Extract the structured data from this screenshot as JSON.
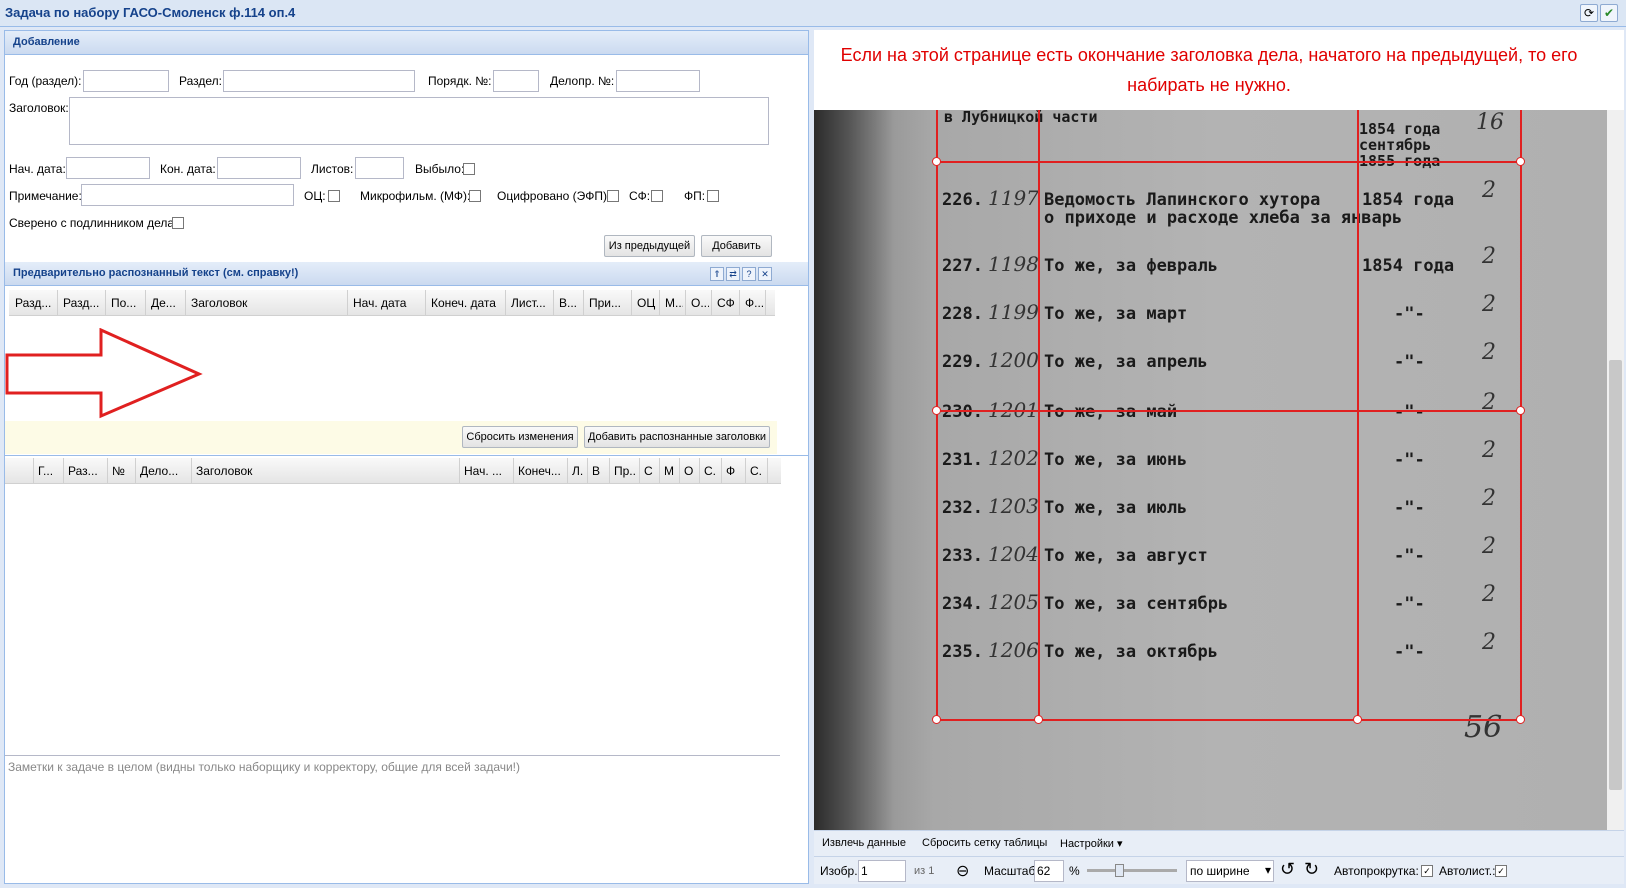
{
  "title": "Задача по набору ГАСО-Смоленск ф.114 оп.4",
  "notice": "Если на этой странице есть окончание заголовка дела, начатого на предыдущей, то его набирать не нужно.",
  "add_panel": {
    "title": "Добавление",
    "year_label": "Год (раздел):",
    "section_label": "Раздел:",
    "order_label": "Порядк. №:",
    "office_no_label": "Делопр. №:",
    "heading_label": "Заголовок:",
    "start_date_label": "Нач. дата:",
    "end_date_label": "Кон. дата:",
    "sheets_label": "Листов:",
    "dropped_label": "Выбыло:",
    "note_label": "Примечание:",
    "oc_label": "ОЦ:",
    "microfilm_label": "Микрофильм. (МФ):",
    "digitized_label": "Оцифровано (ЭФП):",
    "sf_label": "СФ:",
    "fp_label": "ФП:",
    "verified_label": "Сверено с подлинником дела:",
    "from_prev_button": "Из предыдущей",
    "add_button": "Добавить"
  },
  "recognized_panel": {
    "title": "Предварительно распознанный текст (см. справку!)",
    "columns": [
      "Разд...",
      "Разд...",
      "По...",
      "Де...",
      "Заголовок",
      "Нач. дата",
      "Конеч. дата",
      "Лист...",
      "В...",
      "При...",
      "ОЦ",
      "М...",
      "О...",
      "СФ",
      "Ф..."
    ],
    "reset_button": "Сбросить изменения",
    "add_recognized_button": "Добавить распознанные заголовки"
  },
  "main_grid": {
    "columns": [
      "Г...",
      "Раз...",
      "№",
      "Дело...",
      "Заголовок",
      "Нач. ...",
      "Конеч...",
      "Л.",
      "В",
      "Пр...",
      "С",
      "М",
      "О",
      "С.",
      "Ф",
      "С."
    ]
  },
  "notes_placeholder": "Заметки к задаче в целом (видны только наборщику и корректору, общие для всей задачи!)",
  "document": {
    "rows": [
      {
        "num": "226.",
        "hw": "1197",
        "title": "Ведомость Лапинского хутора",
        "title2": "о приходе и расходе хлеба за январь",
        "year": "1854 года",
        "sheets": "2"
      },
      {
        "num": "227.",
        "hw": "1198",
        "title": "То же, за февраль",
        "year": "1854 года",
        "sheets": "2"
      },
      {
        "num": "228.",
        "hw": "1199",
        "title": "То же, за март",
        "year": "-\"-",
        "sheets": "2"
      },
      {
        "num": "229.",
        "hw": "1200",
        "title": "То же, за апрель",
        "year": "-\"-",
        "sheets": "2"
      },
      {
        "num": "230.",
        "hw": "1201",
        "title": "То же, за май",
        "year": "-\"-",
        "sheets": "2"
      },
      {
        "num": "231.",
        "hw": "1202",
        "title": "То же, за июнь",
        "year": "-\"-",
        "sheets": "2"
      },
      {
        "num": "232.",
        "hw": "1203",
        "title": "То же, за июль",
        "year": "-\"-",
        "sheets": "2"
      },
      {
        "num": "233.",
        "hw": "1204",
        "title": "То же, за август",
        "year": "-\"-",
        "sheets": "2"
      },
      {
        "num": "234.",
        "hw": "1205",
        "title": "То же, за сентябрь",
        "year": "-\"-",
        "sheets": "2"
      },
      {
        "num": "235.",
        "hw": "1206",
        "title": "То же, за октябрь",
        "year": "-\"-",
        "sheets": "2"
      }
    ],
    "top_text1": "в Лубницкой части",
    "top_year1": "1854 года",
    "top_year2": "сентябрь",
    "top_year3": "1855 года",
    "top_sheets": "16",
    "page_total": "56"
  },
  "toolbar": {
    "extract": "Извлечь данные",
    "reset_grid": "Сбросить сетку таблицы",
    "settings": "Настройки",
    "image_label": "Изобр.",
    "image_value": "1",
    "of_label": "из 1",
    "scale_label": "Масштаб:",
    "scale_value": "62",
    "percent": "%",
    "fit_value": "по ширине",
    "autoscroll_label": "Автопрокрутка:",
    "autosheet_label": "Автолист.:"
  }
}
